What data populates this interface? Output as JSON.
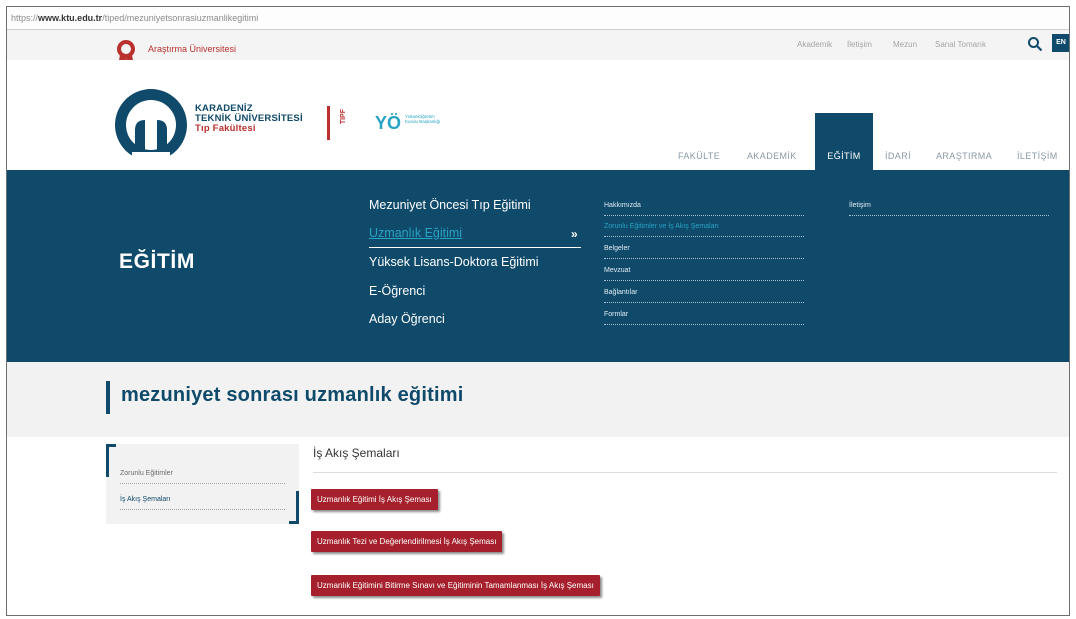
{
  "browser": {
    "url_prefix": "https://",
    "url_host": "www.ktu.edu.tr",
    "url_path": "/tiped/mezuniyetsonrasiuzmanlikegitimi"
  },
  "topbar": {
    "research_label": "Araştırma Üniversitesi",
    "links": [
      "Akademik",
      "İletişim",
      "Mezun",
      "Sanal Tomarık"
    ],
    "lang": "EN"
  },
  "logo": {
    "line1": "KARADENİZ",
    "line2": "TEKNİK ÜNİVERSİTESİ",
    "line3": "Tıp Fakültesi",
    "side_label": "TIPF",
    "yok_mark": "YÖ",
    "yok_sub": "Yükseköğretim Kurulu Başkanlığı"
  },
  "nav": {
    "items": [
      "FAKÜLTE",
      "AKADEMİK",
      "EĞİTİM",
      "İDARİ",
      "ARAŞTIRMA",
      "İLETİŞİM"
    ],
    "active_index": 2
  },
  "mega": {
    "title": "EĞİTİM",
    "items": [
      "Mezuniyet Öncesi Tıp Eğitimi",
      "Uzmanlık Eğitimi",
      "Yüksek Lisans-Doktora Eğitimi",
      "E-Öğrenci",
      "Aday Öğrenci"
    ],
    "current_index": 1,
    "arrow": "»",
    "subitems": [
      "Hakkımızda",
      "Zorunlu Eğitimler ve İş Akış Şemaları",
      "Belgeler",
      "Mevzuat",
      "Bağlantılar",
      "Formlar"
    ],
    "current_sub_index": 1,
    "right_column": [
      "İletişim"
    ]
  },
  "page": {
    "title": "mezuniyet sonrası uzmanlık eğitimi"
  },
  "sidebar": {
    "items": [
      "Zorunlu Eğitimler",
      "İş Akış Şemaları"
    ],
    "current_index": 1
  },
  "content": {
    "title": "İş Akış Şemaları",
    "buttons": [
      "Uzmanlık Eğitimi İş Akış Şeması",
      "Uzmanlık Tezi ve Değerlendirilmesi İş Akış Şeması",
      "Uzmanlık Eğitimini Bitirme Sınavı ve Eğitiminin Tamamlanması İş Akış Şeması"
    ]
  },
  "colors": {
    "brand_blue": "#0f4a6b",
    "accent_red": "#a5202c",
    "highlight_cyan": "#27a3c4"
  }
}
